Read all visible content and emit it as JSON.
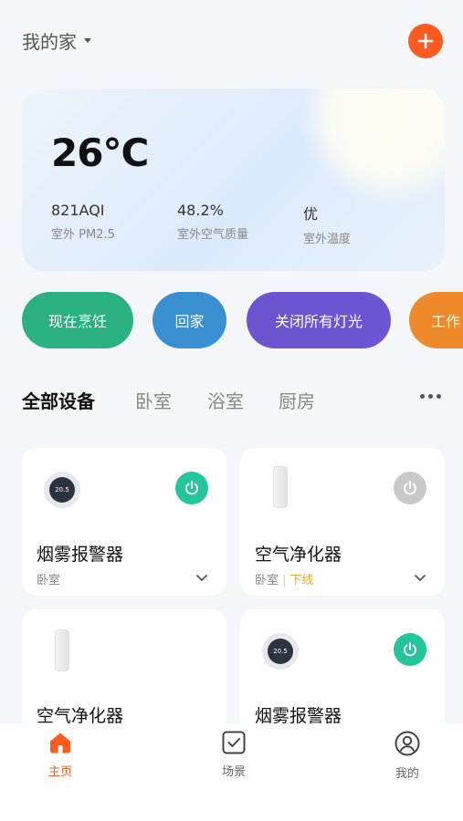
{
  "header": {
    "home_label": "我的家"
  },
  "weather": {
    "temperature": "26°C",
    "stats": [
      {
        "value": "821AQI",
        "label": "室外 PM2.5"
      },
      {
        "value": "48.2%",
        "label": "室外空气质量"
      },
      {
        "value": "优",
        "label": "室外温度"
      }
    ]
  },
  "scenes": [
    {
      "label": "现在烹饪",
      "color": "#2bb07f"
    },
    {
      "label": "回家",
      "color": "#3a8fd0"
    },
    {
      "label": "关闭所有灯光",
      "color": "#6c55d0"
    },
    {
      "label": "工作",
      "color": "#ee8a2a"
    }
  ],
  "tabs": [
    "全部设备",
    "卧室",
    "浴室",
    "厨房"
  ],
  "devices": [
    {
      "name": "烟雾报警器",
      "room": "卧室",
      "status": "",
      "power": "on",
      "display": "20.5"
    },
    {
      "name": "空气净化器",
      "room": "卧室",
      "status": "下线",
      "power": "off"
    },
    {
      "name": "空气净化器"
    },
    {
      "name": "烟雾报警器",
      "power": "on",
      "display": "20.5"
    }
  ],
  "nav": [
    {
      "label": "主页",
      "active": true
    },
    {
      "label": "场景",
      "active": false
    },
    {
      "label": "我的",
      "active": false
    }
  ],
  "colors": {
    "accent": "#ff5a1f",
    "power_on": "#23c69a",
    "power_off": "#c9c9c9",
    "offline": "#f5a623"
  }
}
